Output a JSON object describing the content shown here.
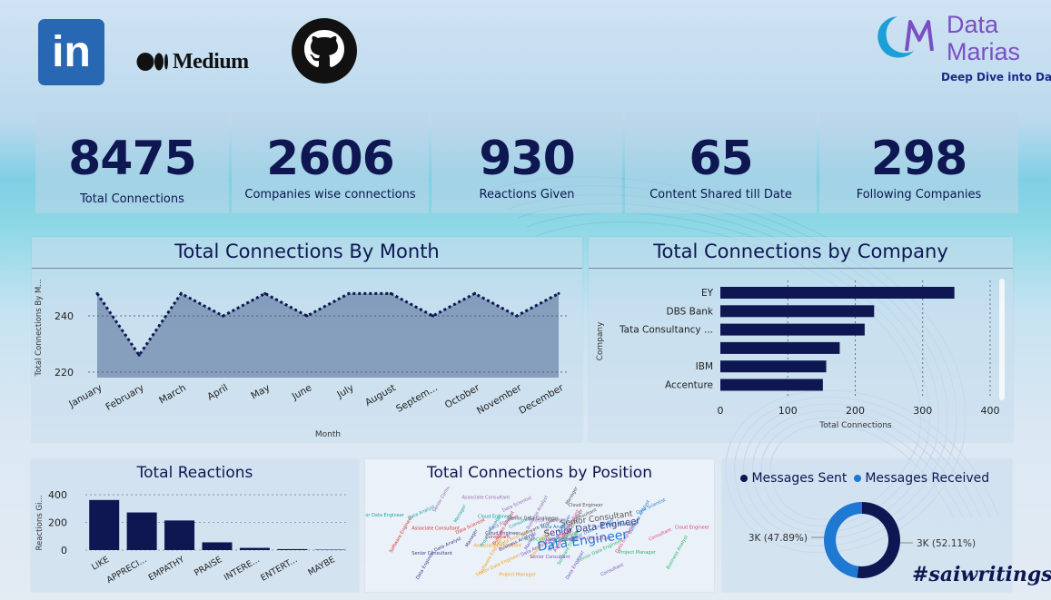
{
  "header": {
    "social": [
      {
        "name": "linkedin-logo",
        "text": "in"
      },
      {
        "name": "medium-logo",
        "text": "Medium"
      },
      {
        "name": "github-logo",
        "text": ""
      }
    ],
    "brand": {
      "name_line1": "Data",
      "name_line2": "Marias",
      "tagline": "Deep Dive into Data",
      "accent": "#7a4fc4"
    }
  },
  "kpis": [
    {
      "value": "8475",
      "label": "Total Connections"
    },
    {
      "value": "2606",
      "label": "Companies wise connections"
    },
    {
      "value": "930",
      "label": "Reactions Given"
    },
    {
      "value": "65",
      "label": "Content Shared till Date"
    },
    {
      "value": "298",
      "label": "Following Companies"
    }
  ],
  "footer_tag": "#saiwritings",
  "chart_data": [
    {
      "type": "area",
      "title": "Total Connections By Month",
      "xlabel": "Month",
      "ylabel": "Total Connections By M...",
      "categories": [
        "January",
        "February",
        "March",
        "April",
        "May",
        "June",
        "July",
        "August",
        "Septem...",
        "October",
        "November",
        "December"
      ],
      "values": [
        248,
        226,
        248,
        240,
        248,
        240,
        248,
        248,
        240,
        248,
        240,
        248
      ],
      "yticks": [
        220,
        240
      ],
      "ylim": [
        218,
        252
      ],
      "color": "#0e1752"
    },
    {
      "type": "bar",
      "orientation": "horizontal",
      "title": "Total Connections by Company",
      "xlabel": "Total Connections",
      "ylabel": "Company",
      "categories": [
        "EY",
        "DBS Bank",
        "Tata Consultancy ...",
        "",
        "IBM",
        "Accenture"
      ],
      "values": [
        347,
        228,
        214,
        177,
        157,
        152
      ],
      "xticks": [
        0,
        100,
        200,
        300,
        400
      ],
      "xlim": [
        0,
        400
      ],
      "color": "#0e1752"
    },
    {
      "type": "bar",
      "title": "Total Reactions",
      "ylabel": "Reactions Gi...",
      "categories": [
        "LIKE",
        "APPRECI...",
        "EMPATHY",
        "PRAISE",
        "INTERE...",
        "ENTERT...",
        "MAYBE"
      ],
      "values": [
        362,
        272,
        214,
        56,
        16,
        7,
        3
      ],
      "yticks": [
        0,
        200,
        400
      ],
      "ylim": [
        0,
        420
      ],
      "color": "#0e1752"
    },
    {
      "type": "other",
      "title": "Total Connections by Position",
      "words": [
        "Data Engineer",
        "Senior Data Engineer",
        "Senior Consultant",
        "Software Engineer",
        "Data Analyst",
        "Associate Consultant",
        "Manager",
        "Data Scientist",
        "Cloud Engineer",
        "Business Analyst",
        "Consultant",
        "Project Manager"
      ]
    },
    {
      "type": "pie",
      "donut": true,
      "legend": [
        {
          "name": "Messages Sent",
          "color": "#0e1752"
        },
        {
          "name": "Messages Received",
          "color": "#1f78d1"
        }
      ],
      "slices": [
        {
          "name": "Messages Sent",
          "value": 52.11,
          "label": "3K (52.11%)",
          "color": "#0e1752"
        },
        {
          "name": "Messages Received",
          "value": 47.89,
          "label": "3K (47.89%)",
          "color": "#1f78d1"
        }
      ]
    }
  ]
}
